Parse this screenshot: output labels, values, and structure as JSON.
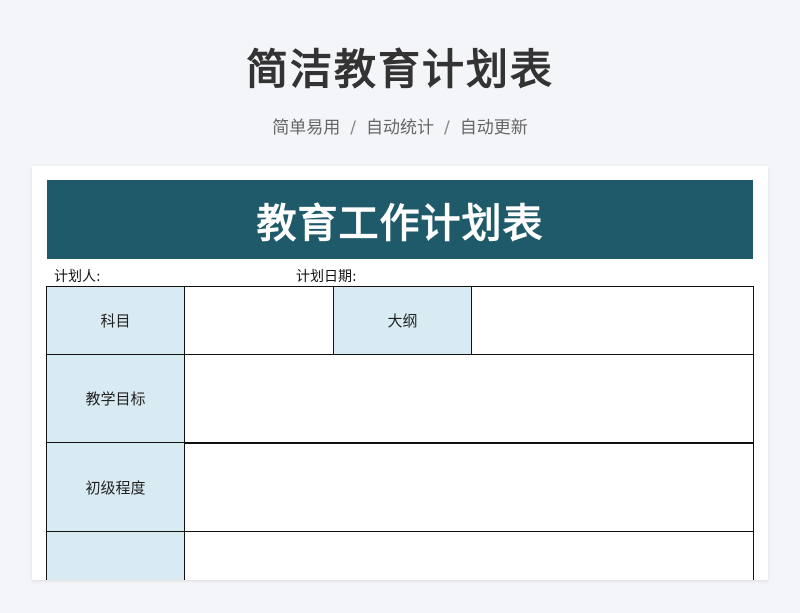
{
  "header": {
    "title": "简洁教育计划表",
    "features": [
      "简单易用",
      "自动统计",
      "自动更新"
    ],
    "separator": "/"
  },
  "sheet": {
    "title": "教育工作计划表",
    "planner_label": "计划人:",
    "plan_date_label": "计划日期:",
    "row_subject": {
      "label": "科目",
      "outline_label": "大纲"
    },
    "row_objective": {
      "label": "教学目标"
    },
    "row_level": {
      "label": "初级程度"
    },
    "row_next": {
      "label": ""
    },
    "colors": {
      "banner": "#1e5a69",
      "header_cell": "#d9ebf2"
    }
  }
}
